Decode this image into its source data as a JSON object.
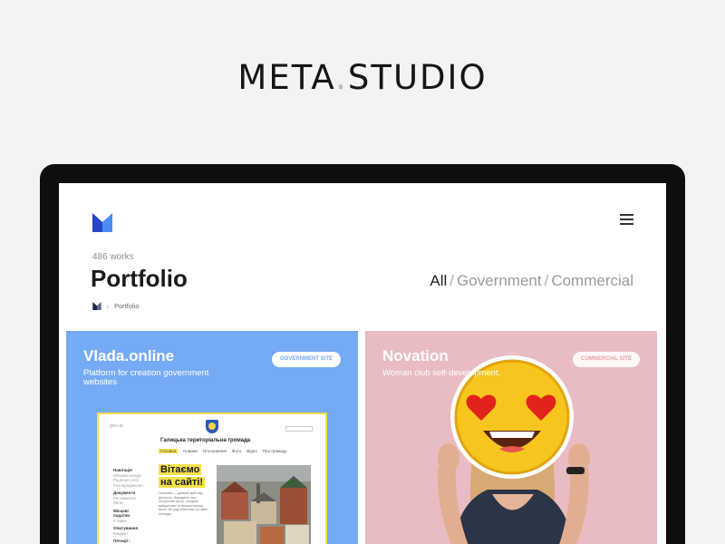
{
  "brand": {
    "name": "META",
    "dot": ".",
    "name2": "STUDIO"
  },
  "header": {
    "logo": "meta-logo-icon",
    "menu": "hamburger-menu-icon"
  },
  "portfolio": {
    "works_count": "486 works",
    "title": "Portfolio",
    "breadcrumb": {
      "home_icon": "meta-logo-icon",
      "current": "Portfolio"
    },
    "filters": [
      {
        "label": "All",
        "active": true
      },
      {
        "label": "Government",
        "active": false
      },
      {
        "label": "Commercial",
        "active": false
      }
    ],
    "separator": "/"
  },
  "cards": [
    {
      "name": "Vlada.online",
      "description": "Platform for creation government websites",
      "badge": "GOVERNMENT SITE",
      "color": "#75aaf4",
      "preview": {
        "domain": "gov.ua",
        "title": "Галицька територіальна громада",
        "nav": [
          "Головна",
          "Новини",
          "Оголошення",
          "Фото",
          "Відео",
          "Про громаду"
        ],
        "sidebar": [
          {
            "h": "Навігація",
            "items": [
              "Місцева влада",
              "Рішення сесії",
              "Розпорядження"
            ]
          },
          {
            "h": "Документи",
            "items": [
              "Регламенти",
              "Звіти"
            ]
          },
          {
            "h": "Місцеві податки",
            "items": [
              "Ставки"
            ]
          },
          {
            "h": "Опитування",
            "items": [
              "Бюджет"
            ]
          },
          {
            "h": "Петиції ›",
            "items": []
          }
        ],
        "welcome_1": "Вітаємо",
        "welcome_2": "на сайті!",
        "lorem": "Галичина — древній край над Дністром. Відвідайте наш історичний центр, оглядові майданчики та затишні вулиці міста. Ми раді вітати вас на сайті громади."
      }
    },
    {
      "name": "Novation",
      "description": "Woman club self-development.",
      "badge": "COMMERCIAL SITE",
      "color": "#e8bcc2"
    }
  ]
}
